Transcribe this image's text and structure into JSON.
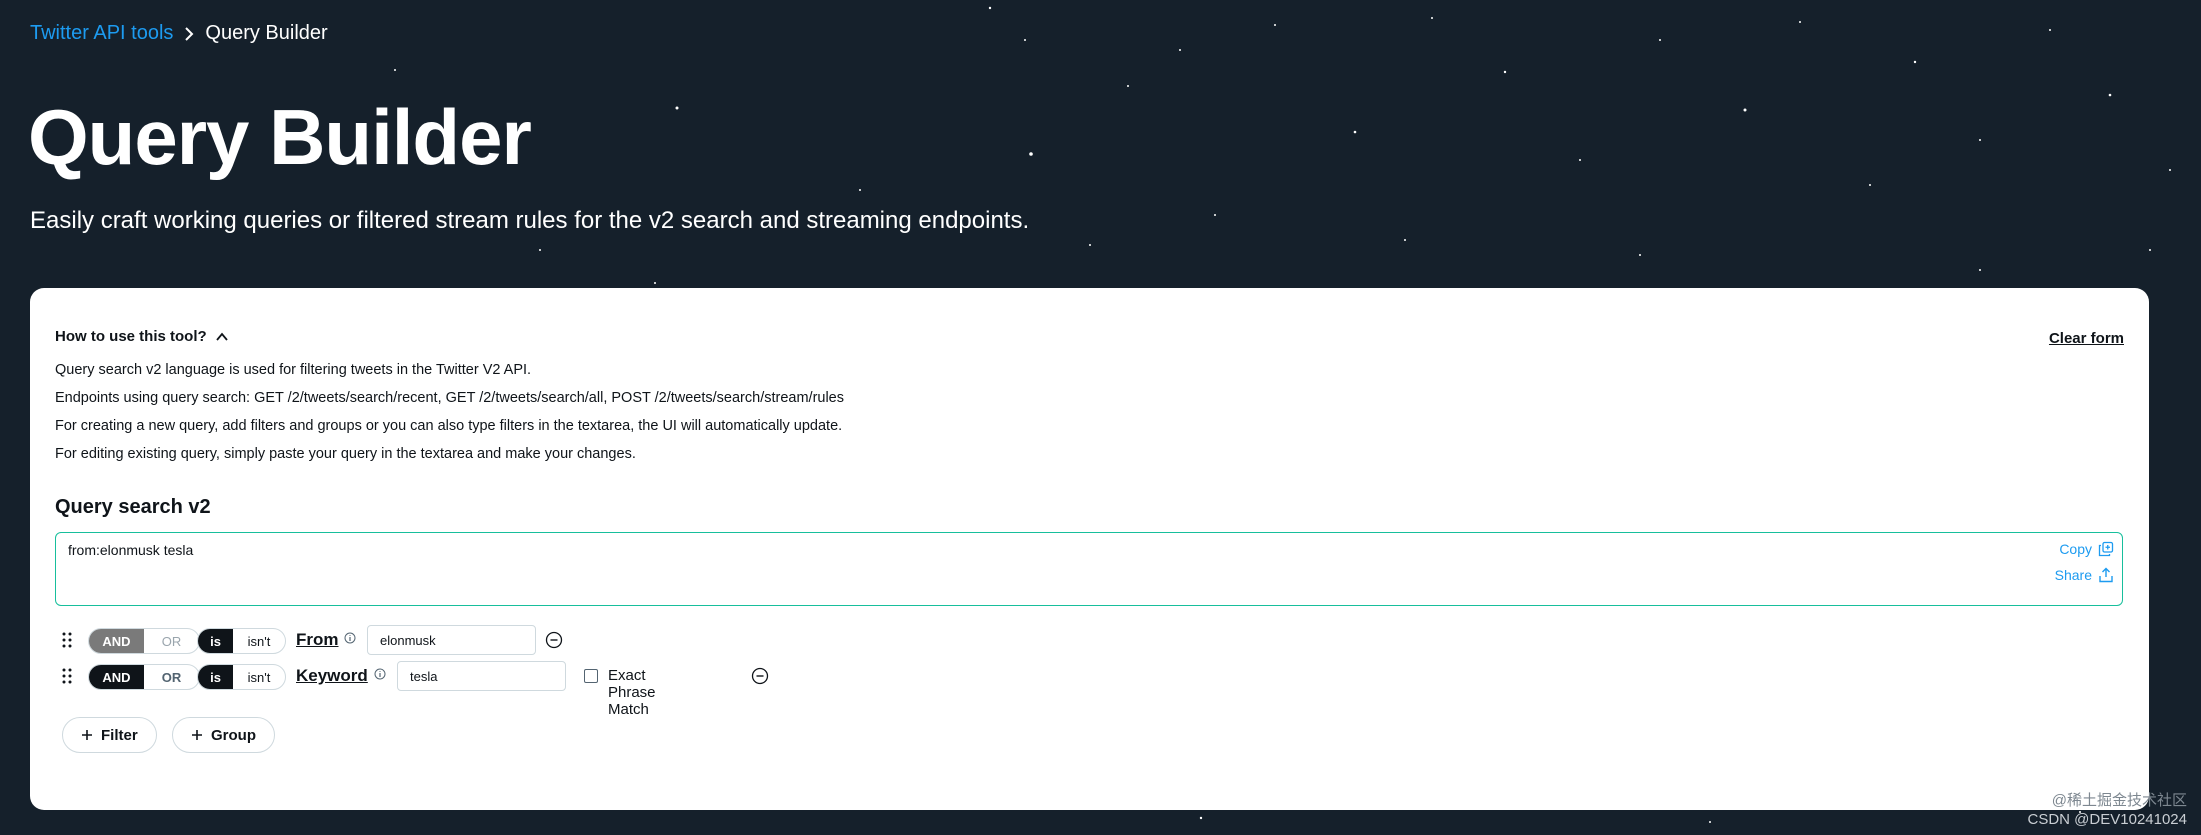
{
  "breadcrumb": {
    "parent": "Twitter API tools",
    "separator": ">",
    "current": "Query Builder"
  },
  "hero": {
    "title": "Query Builder",
    "subtitle": "Easily craft working queries or filtered stream rules for the v2 search and streaming endpoints."
  },
  "howto": {
    "toggle_label": "How to use this tool?",
    "lines": [
      "Query search v2 language is used for filtering tweets in the Twitter V2 API.",
      "Endpoints using query search: GET /2/tweets/search/recent, GET /2/tweets/search/all, POST /2/tweets/search/stream/rules",
      "For creating a new query, add filters and groups or you can also type filters in the textarea, the UI will automatically update.",
      "For editing existing query, simply paste your query in the textarea and make your changes."
    ]
  },
  "clear_form_label": "Clear form",
  "query": {
    "section_title": "Query search v2",
    "value": "from:elonmusk tesla",
    "copy_label": "Copy",
    "share_label": "Share"
  },
  "filters": [
    {
      "and_label": "AND",
      "or_label": "OR",
      "is_label": "is",
      "isnt_label": "isn't",
      "field_label": "From",
      "value": "elonmusk"
    },
    {
      "and_label": "AND",
      "or_label": "OR",
      "is_label": "is",
      "isnt_label": "isn't",
      "field_label": "Keyword",
      "value": "tesla",
      "exact_phrase_label": "Exact Phrase Match",
      "exact_phrase_checked": false
    }
  ],
  "buttons": {
    "add_filter": "Filter",
    "add_group": "Group"
  },
  "watermark": {
    "line1": "@稀土掘金技术社区",
    "line2": "CSDN @DEV10241024"
  },
  "colors": {
    "background": "#15202b",
    "accent": "#1d9bf0",
    "query_border": "#17bf9c"
  },
  "icons": [
    "chevron-right-icon",
    "chevron-up-icon",
    "copy-icon",
    "share-icon",
    "drag-handle-icon",
    "info-icon",
    "remove-circle-icon",
    "plus-icon"
  ]
}
